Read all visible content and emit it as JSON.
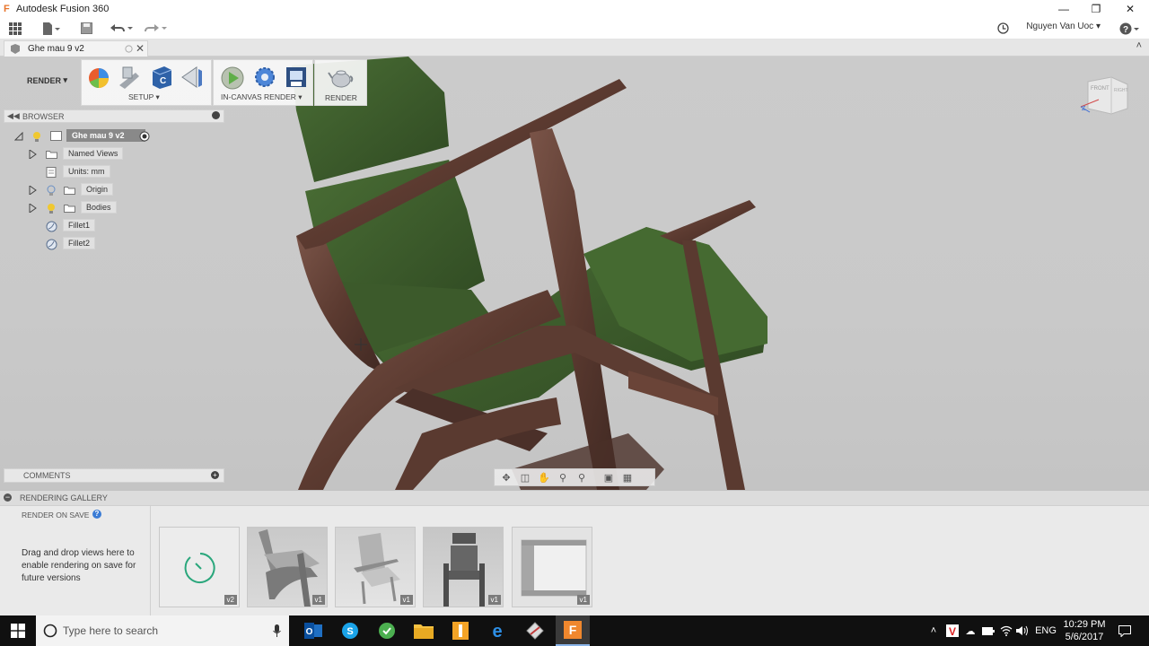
{
  "window": {
    "title": "Autodesk Fusion 360",
    "app_logo": "F"
  },
  "quick_access": {
    "user_name": "Nguyen Van Uoc",
    "icons": [
      "apps-grid-icon",
      "file-icon",
      "save-icon",
      "undo-icon",
      "redo-icon",
      "history-icon",
      "help-icon"
    ]
  },
  "doc_tab": {
    "label": "Ghe mau 9 v2"
  },
  "ribbon": {
    "workspace": "RENDER",
    "panels": [
      {
        "label": "SETUP"
      },
      {
        "label": "IN-CANVAS RENDER"
      },
      {
        "label": "RENDER"
      }
    ]
  },
  "browser": {
    "title": "BROWSER",
    "root": "Ghe mau 9 v2",
    "items": [
      {
        "label": "Named Views"
      },
      {
        "label": "Units: mm"
      },
      {
        "label": "Origin"
      },
      {
        "label": "Bodies"
      },
      {
        "label": "Fillet1"
      },
      {
        "label": "Fillet2"
      }
    ]
  },
  "viewcube": {
    "front_label": "FRONT",
    "right_label": "RIGHT"
  },
  "comments": {
    "title": "COMMENTS"
  },
  "gallery": {
    "title": "RENDERING GALLERY",
    "render_on_save": "RENDER ON SAVE",
    "help": "?",
    "drop_hint": "Drag and drop views here to enable rendering on save for future versions",
    "thumbnails": [
      {
        "version": "v2",
        "kind": "pending"
      },
      {
        "version": "v1",
        "kind": "side"
      },
      {
        "version": "v1",
        "kind": "perspective"
      },
      {
        "version": "v1",
        "kind": "front"
      },
      {
        "version": "v1",
        "kind": "top"
      }
    ]
  },
  "taskbar": {
    "search_placeholder": "Type here to search",
    "language": "ENG",
    "time": "10:29 PM",
    "date": "5/6/2017"
  },
  "colors": {
    "wood": "#5e3a30",
    "fabric": "#3f5e2c",
    "accent": "#3a7bd5",
    "taskbar": "#101010"
  }
}
